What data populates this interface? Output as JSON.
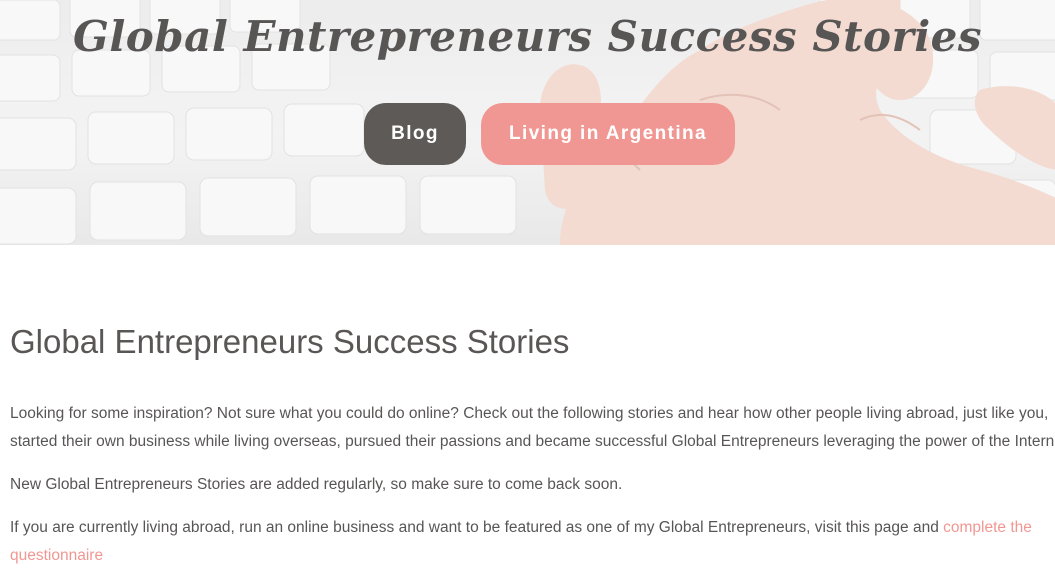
{
  "header": {
    "site_title": "Global Entrepreneurs Success Stories",
    "nav": [
      {
        "label": "Blog",
        "color": "#5e5a57"
      },
      {
        "label": "Living in Argentina",
        "color": "#f19793"
      }
    ]
  },
  "main": {
    "page_title": "Global Entrepreneurs Success Stories",
    "paragraph1_line1": "Looking for some inspiration? Not sure what you could do online? Check out the following stories and hear how other people living abroad, just like you,",
    "paragraph1_line2": "started their own business while living overseas, pursued their passions and became successful Global Entrepreneurs leveraging the power of the Intern",
    "paragraph2": "New Global Entrepreneurs Stories are added regularly, so make sure to come back soon.",
    "paragraph3_text": "If you are currently living abroad, run an online business and want to be featured as one of my Global Entrepreneurs, visit this page and ",
    "paragraph3_link": "complete the",
    "paragraph3_link_cont": "questionnaire"
  },
  "colors": {
    "text": "#585555",
    "accent": "#f19793",
    "dark_button": "#5e5a57"
  },
  "icons": [
    "hero-keyboard-hand-image"
  ]
}
